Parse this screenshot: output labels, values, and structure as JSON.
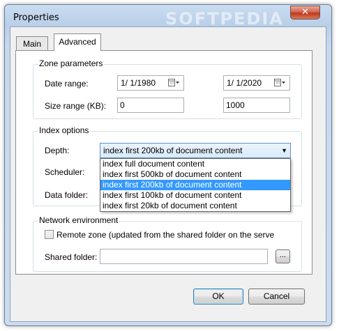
{
  "window": {
    "title": "Properties",
    "watermark": "SOFTPEDIA",
    "close_label": "✕"
  },
  "tabs": [
    {
      "label": "Main"
    },
    {
      "label": "Advanced"
    }
  ],
  "zone": {
    "title": "Zone parameters",
    "date_label": "Date range:",
    "date_from": "1/ 1/1980",
    "date_to": "1/ 1/2020",
    "size_label": "Size range (KB):",
    "size_from": "0",
    "size_to": "1000"
  },
  "index": {
    "title": "Index options",
    "depth_label": "Depth:",
    "depth_value": "index first 200kb of document content",
    "scheduler_label": "Scheduler:",
    "folder_label": "Data folder:",
    "options": [
      "index full document content",
      "index first 500kb of document content",
      "index first 200kb of document content",
      "index first 100kb of document content",
      "index first 20kb of document content"
    ],
    "selected_index": 2
  },
  "network": {
    "title": "Network environment",
    "remote_label": "Remote zone (updated from the shared folder on the server)",
    "remote_checked": false,
    "shared_label": "Shared folder:",
    "shared_value": "",
    "browse_label": "..."
  },
  "buttons": {
    "ok": "OK",
    "cancel": "Cancel"
  },
  "colors": {
    "selection": "#3399ff",
    "titlebar": "#b9cfe8"
  }
}
